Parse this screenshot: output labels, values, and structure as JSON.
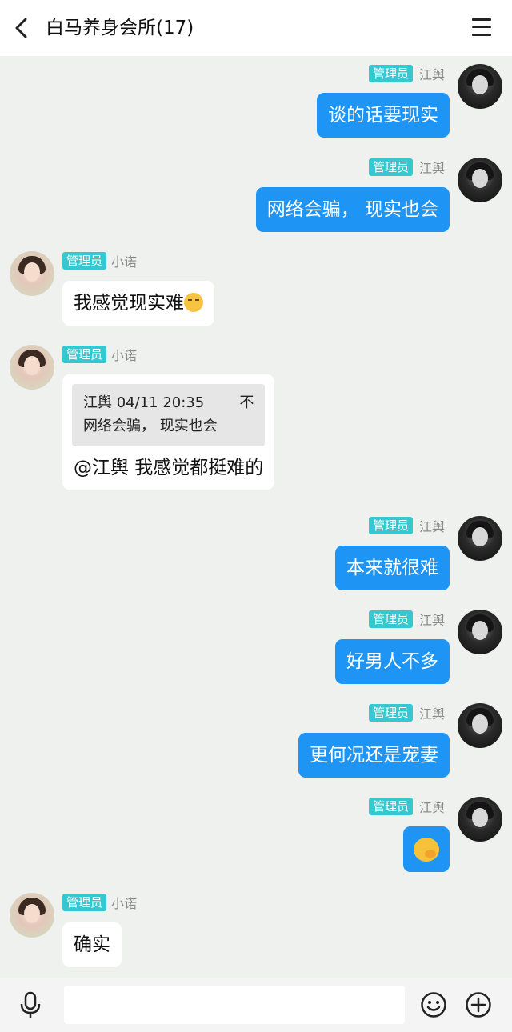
{
  "header": {
    "title": "白马养身会所(17)",
    "back_icon": "chevron-left-icon",
    "menu_icon": "hamburger-menu-icon"
  },
  "badge": "管理员",
  "messages": [
    {
      "sender": "江舆",
      "side": "right",
      "text": "谈的话要现实"
    },
    {
      "sender": "江舆",
      "side": "right",
      "text": "网络会骗， 现实也会"
    },
    {
      "sender": "小诺",
      "side": "left",
      "text": "我感觉现实难",
      "emoji": "flushed-face-emoji"
    },
    {
      "sender": "小诺",
      "side": "left",
      "quote": {
        "author": "江舆",
        "time": "04/11 20:35",
        "text": "网络会骗， 现实也会"
      },
      "text": "@江舆 我感觉都挺难的"
    },
    {
      "sender": "江舆",
      "side": "right",
      "text": "本来就很难"
    },
    {
      "sender": "江舆",
      "side": "right",
      "text": "好男人不多"
    },
    {
      "sender": "江舆",
      "side": "right",
      "text": "更何况还是宠妻"
    },
    {
      "sender": "江舆",
      "side": "right",
      "emoji": "shushing-face-emoji"
    },
    {
      "sender": "小诺",
      "side": "left",
      "text": "确实"
    }
  ],
  "footer": {
    "input_placeholder": "",
    "mic_icon": "microphone-icon",
    "emoji_icon": "smiley-icon",
    "plus_icon": "plus-circle-icon"
  },
  "colors": {
    "bubble_me": "#1e95f5",
    "badge": "#36c8d0",
    "background": "#eef1ee"
  }
}
